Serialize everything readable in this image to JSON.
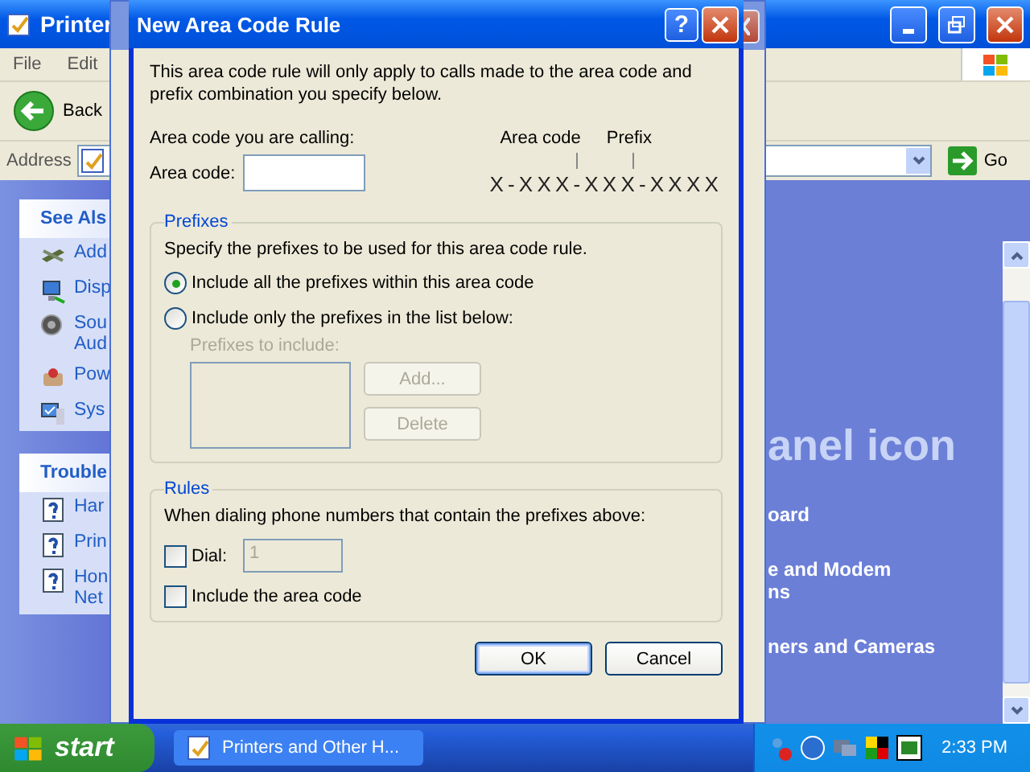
{
  "explorer": {
    "title": "Printer",
    "menu": [
      "File",
      "Edit"
    ],
    "back_label": "Back",
    "address_label": "Address",
    "go_label": "Go",
    "see_also": {
      "title": "See Als",
      "items": [
        {
          "lines": [
            "Add"
          ],
          "kind": "tools"
        },
        {
          "lines": [
            "Disp"
          ],
          "kind": "display"
        },
        {
          "lines": [
            "Sou",
            "Aud"
          ],
          "kind": "speaker"
        },
        {
          "lines": [
            "Pow"
          ],
          "kind": "power"
        },
        {
          "lines": [
            "Sys"
          ],
          "kind": "computer"
        }
      ]
    },
    "troubleshooters": {
      "title": "Trouble",
      "items": [
        {
          "lines": [
            "Har"
          ],
          "kind": "help"
        },
        {
          "lines": [
            "Prin"
          ],
          "kind": "help"
        },
        {
          "lines": [
            "Hon",
            "Net"
          ],
          "kind": "help"
        }
      ]
    },
    "heading": "anel icon",
    "links": [
      {
        "lines": [
          "oard"
        ]
      },
      {
        "lines": [
          "e and Modem",
          "ns"
        ]
      },
      {
        "lines": [
          "ners and Cameras"
        ]
      }
    ]
  },
  "dialog": {
    "title": "New Area Code Rule",
    "help_button": "?",
    "intro": "This area code rule will only apply to calls made to the area code and prefix combination you specify below.",
    "calling_label": "Area code you are calling:",
    "area_code": {
      "label": "Area code:"
    },
    "format": {
      "area_code_label": "Area code",
      "prefix_label": "Prefix",
      "pattern": "X-XXX-XXX-XXXX"
    },
    "prefixes": {
      "title": "Prefixes",
      "instruction": "Specify the prefixes to be used for this area code rule.",
      "options": [
        {
          "label": "Include all the prefixes within this area code",
          "selected": true
        },
        {
          "label": "Include only the prefixes in the list below:",
          "selected": false
        }
      ],
      "list_label": "Prefixes to include:",
      "list_disabled": true,
      "buttons": [
        {
          "label": "Add...",
          "disabled": true
        },
        {
          "label": "Delete",
          "disabled": true
        }
      ]
    },
    "rules": {
      "title": "Rules",
      "instruction": "When dialing phone numbers that contain the prefixes above:",
      "dial": {
        "label": "Dial:",
        "checked": false,
        "value": "1",
        "disabled": true
      },
      "include_area_code": {
        "label": "Include the area code",
        "checked": false
      }
    },
    "buttons": [
      {
        "label": "OK",
        "default": true
      },
      {
        "label": "Cancel",
        "default": false
      }
    ]
  },
  "taskbar": {
    "start": "start",
    "tasks": [
      {
        "label": "Printers and Other H...",
        "selected": false
      }
    ],
    "clock": "2:33 PM"
  }
}
